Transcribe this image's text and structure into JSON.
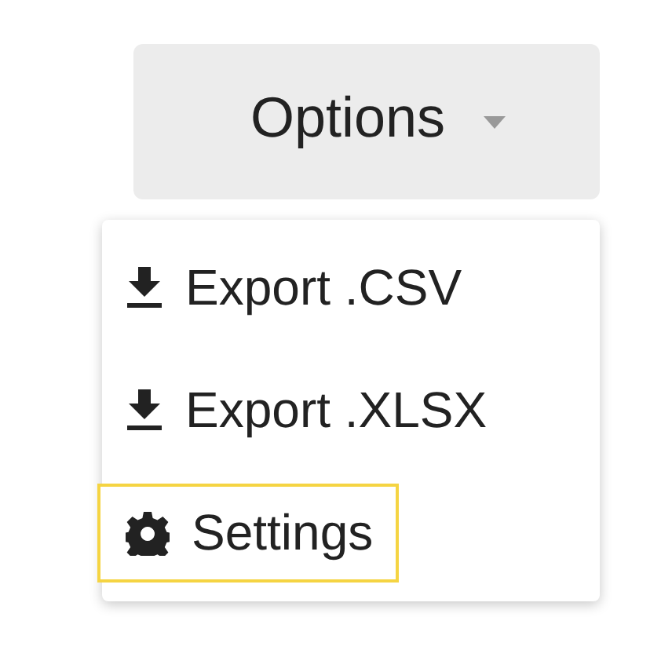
{
  "options_button": {
    "label": "Options"
  },
  "menu": {
    "items": [
      {
        "kind": "download",
        "label": "Export .CSV",
        "focused": false
      },
      {
        "kind": "download",
        "label": "Export .XLSX",
        "focused": false
      },
      {
        "kind": "settings",
        "label": "Settings",
        "focused": true
      }
    ]
  }
}
